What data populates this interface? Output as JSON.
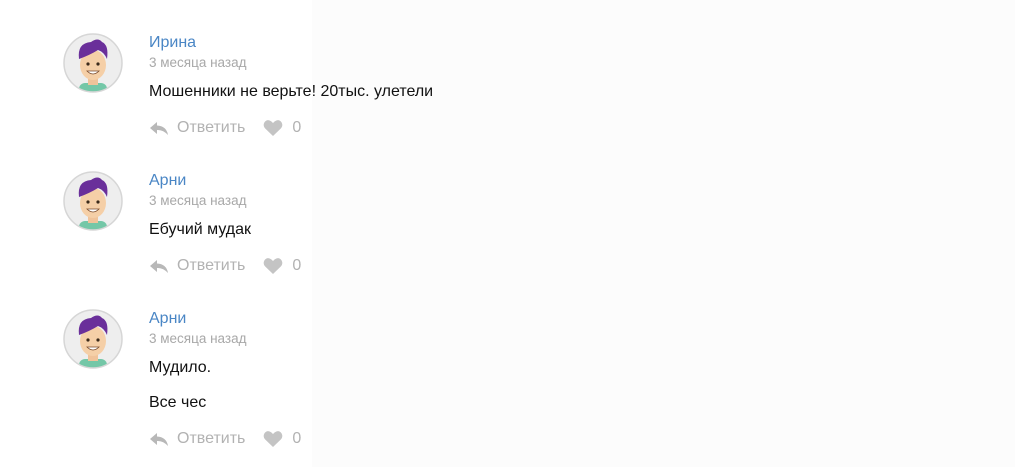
{
  "comments": [
    {
      "author": "Ирина",
      "date": "3 месяца назад",
      "lines": [
        "Мошенники не верьте! 20тыс. улетели"
      ],
      "reply_label": "Ответить",
      "likes": "0"
    },
    {
      "author": "Арни",
      "date": "3 месяца назад",
      "lines": [
        "Ебучий мудак"
      ],
      "reply_label": "Ответить",
      "likes": "0"
    },
    {
      "author": "Арни",
      "date": "3 месяца назад",
      "lines": [
        "Мудило.",
        "Все чес"
      ],
      "reply_label": "Ответить",
      "likes": "0"
    }
  ],
  "colors": {
    "author": "#4a86c5",
    "muted": "#a8a8a8",
    "action": "#b2b2b2",
    "avatar_hair": "#6a2f9a",
    "avatar_shirt": "#74c7a7"
  },
  "icons": {
    "avatar": "cartoon-avatar-icon",
    "reply": "reply-arrow-icon",
    "like": "heart-icon"
  }
}
